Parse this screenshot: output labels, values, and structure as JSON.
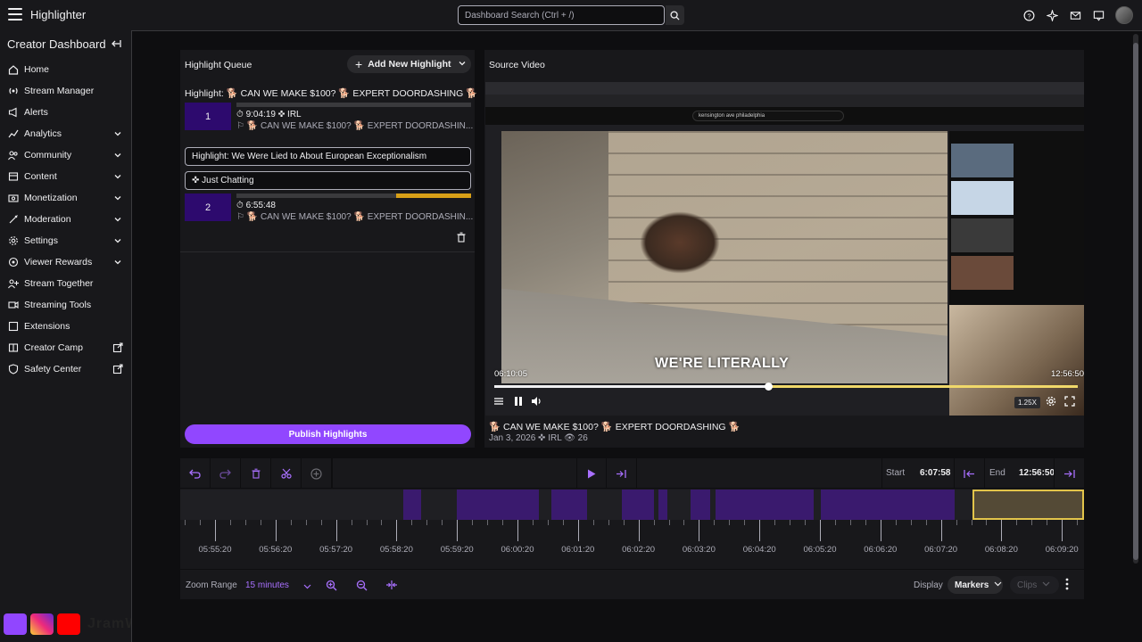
{
  "app": {
    "title": "Highlighter",
    "search_placeholder": "Dashboard Search (Ctrl + /)"
  },
  "sidebar": {
    "title": "Creator Dashboard",
    "items": [
      {
        "label": "Home",
        "icon": "home-icon",
        "chevron": false,
        "external": false
      },
      {
        "label": "Stream Manager",
        "icon": "stream-manager-icon",
        "chevron": false,
        "external": false
      },
      {
        "label": "Alerts",
        "icon": "alerts-icon",
        "chevron": false,
        "external": false
      },
      {
        "label": "Analytics",
        "icon": "analytics-icon",
        "chevron": true,
        "external": false
      },
      {
        "label": "Community",
        "icon": "community-icon",
        "chevron": true,
        "external": false
      },
      {
        "label": "Content",
        "icon": "content-icon",
        "chevron": true,
        "external": false
      },
      {
        "label": "Monetization",
        "icon": "monetization-icon",
        "chevron": true,
        "external": false
      },
      {
        "label": "Moderation",
        "icon": "moderation-icon",
        "chevron": true,
        "external": false
      },
      {
        "label": "Settings",
        "icon": "settings-icon",
        "chevron": true,
        "external": false
      },
      {
        "label": "Viewer Rewards",
        "icon": "viewer-rewards-icon",
        "chevron": true,
        "external": false
      },
      {
        "label": "Stream Together",
        "icon": "stream-together-icon",
        "chevron": false,
        "external": false
      },
      {
        "label": "Streaming Tools",
        "icon": "streaming-tools-icon",
        "chevron": false,
        "external": false
      },
      {
        "label": "Extensions",
        "icon": "extensions-icon",
        "chevron": false,
        "external": false
      },
      {
        "label": "Creator Camp",
        "icon": "creator-camp-icon",
        "chevron": false,
        "external": true
      },
      {
        "label": "Safety Center",
        "icon": "safety-center-icon",
        "chevron": false,
        "external": true
      }
    ]
  },
  "queue": {
    "header": "Highlight Queue",
    "add_button": "Add New Highlight",
    "highlight1": {
      "title": "Highlight: 🐕 CAN WE MAKE $100? 🐕 EXPERT DOORDASHING 🐕",
      "number": "1",
      "time": "9:04:19  ✜ IRL",
      "sub": "🐕 CAN WE MAKE $100? 🐕 EXPERT DOORDASHIN..."
    },
    "title_field": "Highlight: We Were Lied to About European Exceptionalism",
    "category_field": "Just Chatting",
    "highlight2": {
      "number": "2",
      "time": "6:55:48",
      "sub": "🐕 CAN WE MAKE $100? 🐕 EXPERT DOORDASHIN...",
      "progress_start": 0.68
    },
    "publish_button": "Publish Highlights"
  },
  "video": {
    "header": "Source Video",
    "yt_search": "kensington ave philadelphia",
    "caption": "WE'RE LITERALLY",
    "time_current": "06:10:05",
    "time_end": "12:56:50",
    "progress": 0.47,
    "speed": "1.25X",
    "meta_title": "🐕 CAN WE MAKE $100? 🐕 EXPERT DOORDASHING 🐕",
    "meta_sub": "Jan 3, 2026  ✜ IRL  👁 26"
  },
  "timeline": {
    "start_label": "Start",
    "start_value": "6:07:58",
    "end_label": "End",
    "end_value": "12:56:50",
    "ticks": [
      "05:55:20",
      "05:56:20",
      "05:57:20",
      "05:58:20",
      "05:59:20",
      "06:00:20",
      "06:01:20",
      "06:02:20",
      "06:03:20",
      "06:04:20",
      "06:05:20",
      "06:06:20",
      "06:07:20",
      "06:08:20",
      "06:09:20"
    ],
    "zoom_label": "Zoom Range",
    "zoom_value": "15 minutes",
    "display_label": "Display",
    "markers_label": "Markers",
    "clips_label": "Clips"
  },
  "watermark": {
    "text": "JramWilton"
  },
  "colors": {
    "accent": "#9147ff",
    "selection": "#e2c44a",
    "segment": "#3a1a6e"
  }
}
